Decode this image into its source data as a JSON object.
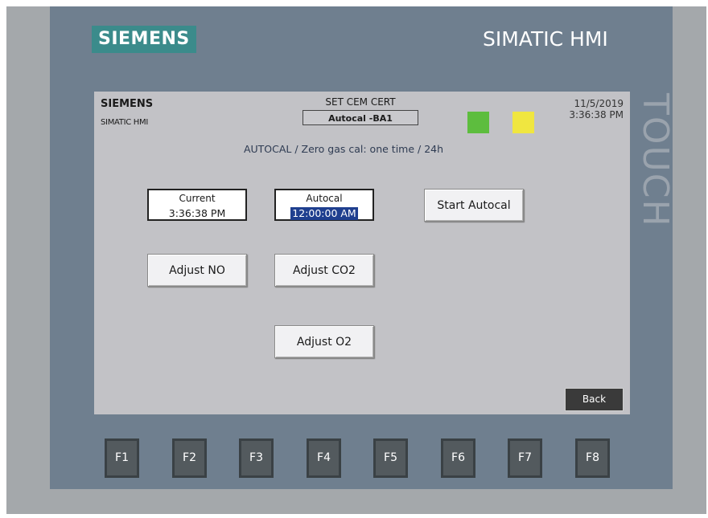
{
  "device": {
    "brand": "SIEMENS",
    "product": "SIMATIC HMI",
    "touch_label": "TOUCH",
    "colors": {
      "bezel": "#6f7f8f",
      "logo_bg": "#3b8b8b",
      "screen_bg": "#c2c2c6"
    }
  },
  "screen": {
    "header": {
      "brand": "SIEMENS",
      "product": "SIMATIC HMI",
      "title": "SET CEM CERT",
      "device_name": "Autocal -BA1",
      "date": "11/5/2019",
      "time": "3:36:38 PM"
    },
    "indicators": [
      {
        "name": "green-indicator",
        "color": "#5dbd3e"
      },
      {
        "name": "yellow-indicator",
        "color": "#f0e640"
      }
    ],
    "subtitle": "AUTOCAL / Zero gas cal: one time / 24h",
    "current": {
      "label": "Current",
      "value": "3:36:38 PM"
    },
    "autocal": {
      "label": "Autocal",
      "value": "12:00:00 AM"
    },
    "buttons": {
      "start_autocal": "Start Autocal",
      "adjust_no": "Adjust NO",
      "adjust_co2": "Adjust CO2",
      "adjust_o2": "Adjust O2",
      "back": "Back"
    }
  },
  "function_keys": [
    "F1",
    "F2",
    "F3",
    "F4",
    "F5",
    "F6",
    "F7",
    "F8"
  ]
}
